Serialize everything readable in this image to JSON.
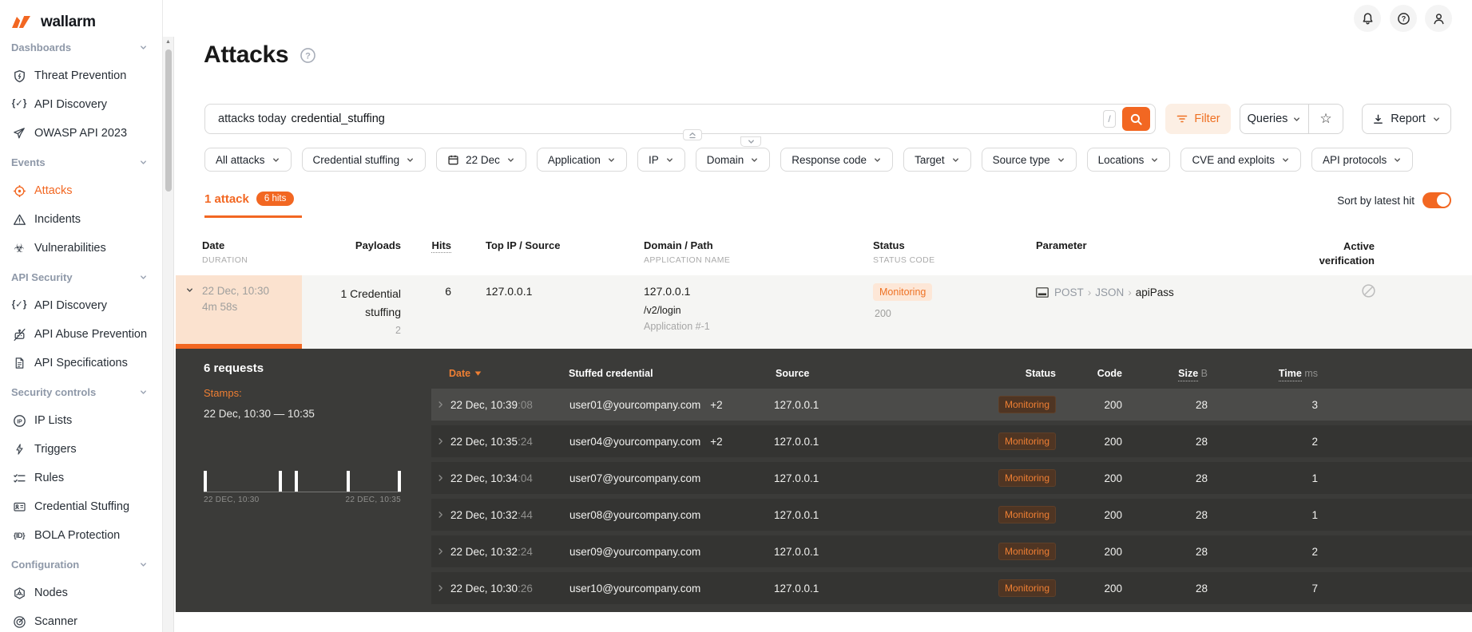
{
  "colors": {
    "accent": "#f26722",
    "panel_bg": "#3b3b39",
    "peach": "#fbe2cf"
  },
  "brand": {
    "logo_text": "wallarm"
  },
  "topbar": {
    "icon_names": [
      "notifications-bell",
      "help-circle",
      "user-account"
    ]
  },
  "sidebar": {
    "items": [
      {
        "type": "header",
        "label": "Dashboards"
      },
      {
        "type": "item",
        "label": "Threat Prevention",
        "icon": "shield-bolt"
      },
      {
        "type": "item",
        "label": "API Discovery",
        "icon": "braces-check"
      },
      {
        "type": "item",
        "label": "OWASP API 2023",
        "icon": "paper-plane"
      },
      {
        "type": "header",
        "label": "Events"
      },
      {
        "type": "item",
        "label": "Attacks",
        "icon": "target",
        "active": true
      },
      {
        "type": "item",
        "label": "Incidents",
        "icon": "warning-triangle"
      },
      {
        "type": "item",
        "label": "Vulnerabilities",
        "icon": "biohazard"
      },
      {
        "type": "header",
        "label": "API Security"
      },
      {
        "type": "item",
        "label": "API Discovery",
        "icon": "braces-check"
      },
      {
        "type": "item",
        "label": "API Abuse Prevention",
        "icon": "bot-crossed"
      },
      {
        "type": "item",
        "label": "API Specifications",
        "icon": "doc-lines"
      },
      {
        "type": "header",
        "label": "Security controls"
      },
      {
        "type": "item",
        "label": "IP Lists",
        "icon": "ip-circle"
      },
      {
        "type": "item",
        "label": "Triggers",
        "icon": "bolt"
      },
      {
        "type": "item",
        "label": "Rules",
        "icon": "checklist"
      },
      {
        "type": "item",
        "label": "Credential Stuffing",
        "icon": "id-card"
      },
      {
        "type": "item",
        "label": "BOLA Protection",
        "icon": "id-braces"
      },
      {
        "type": "header",
        "label": "Configuration"
      },
      {
        "type": "item",
        "label": "Nodes",
        "icon": "nodes"
      },
      {
        "type": "item",
        "label": "Scanner",
        "icon": "radar"
      }
    ]
  },
  "page": {
    "title": "Attacks"
  },
  "search": {
    "value_prefix": "attacks today",
    "value_token": "credential_stuffing",
    "shortcut": "/"
  },
  "actions": {
    "filter": "Filter",
    "queries": "Queries",
    "report": "Report"
  },
  "filters": {
    "chips": [
      {
        "label": "All attacks"
      },
      {
        "label": "Credential stuffing"
      },
      {
        "label": "22 Dec",
        "icon": "calendar"
      },
      {
        "label": "Application"
      },
      {
        "label": "IP"
      },
      {
        "label": "Domain"
      },
      {
        "label": "Response code"
      },
      {
        "label": "Target"
      },
      {
        "label": "Source type"
      },
      {
        "label": "Locations"
      },
      {
        "label": "CVE and exploits"
      },
      {
        "label": "API protocols"
      }
    ]
  },
  "summary": {
    "attacks_tab": "1 attack",
    "hits_badge": "6 hits",
    "sort_label": "Sort by latest hit"
  },
  "table": {
    "columns": [
      {
        "main": "Date",
        "sub": "DURATION"
      },
      {
        "main": "Payloads"
      },
      {
        "main": "Hits"
      },
      {
        "main": "Top IP / Source"
      },
      {
        "main": "Domain / Path",
        "sub": "APPLICATION NAME"
      },
      {
        "main": "Status",
        "sub": "STATUS CODE"
      },
      {
        "main": "Parameter"
      },
      {
        "main": "Active verification"
      }
    ],
    "row": {
      "date": "22 Dec, 10:30",
      "duration": "4m 58s",
      "payload": "1 Credential stuffing",
      "payload_count": "2",
      "hits": "6",
      "top_ip": "127.0.0.1",
      "domain": "127.0.0.1",
      "path": "/v2/login",
      "app_name": "Application #-1",
      "status": "Monitoring",
      "status_code": "200",
      "param_method": "POST",
      "param_format": "JSON",
      "param_name": "apiPass"
    }
  },
  "panel": {
    "requests_title": "6 requests",
    "stamps_label": "Stamps:",
    "range": "22 Dec, 10:30 — 10:35",
    "histogram": {
      "type": "event-ticks",
      "positions_fraction": [
        0,
        0.387,
        0.469,
        0.737,
        1.0
      ],
      "start_label": "22 DEC, 10:30",
      "end_label": "22 DEC, 10:35"
    },
    "table_headers": {
      "date": "Date",
      "credential": "Stuffed credential",
      "source": "Source",
      "status": "Status",
      "code": "Code",
      "size": "Size",
      "size_unit": "B",
      "time": "Time",
      "time_unit": "ms"
    },
    "rows": [
      {
        "date": "22 Dec, 10:39",
        "seconds": ":08",
        "credential": "user01@yourcompany.com",
        "extra": "+2",
        "source": "127.0.0.1",
        "status": "Monitoring",
        "code": "200",
        "size": "28",
        "time": "3",
        "highlighted": true
      },
      {
        "date": "22 Dec, 10:35",
        "seconds": ":24",
        "credential": "user04@yourcompany.com",
        "extra": "+2",
        "source": "127.0.0.1",
        "status": "Monitoring",
        "code": "200",
        "size": "28",
        "time": "2"
      },
      {
        "date": "22 Dec, 10:34",
        "seconds": ":04",
        "credential": "user07@yourcompany.com",
        "extra": "",
        "source": "127.0.0.1",
        "status": "Monitoring",
        "code": "200",
        "size": "28",
        "time": "1"
      },
      {
        "date": "22 Dec, 10:32",
        "seconds": ":44",
        "credential": "user08@yourcompany.com",
        "extra": "",
        "source": "127.0.0.1",
        "status": "Monitoring",
        "code": "200",
        "size": "28",
        "time": "1"
      },
      {
        "date": "22 Dec, 10:32",
        "seconds": ":24",
        "credential": "user09@yourcompany.com",
        "extra": "",
        "source": "127.0.0.1",
        "status": "Monitoring",
        "code": "200",
        "size": "28",
        "time": "2"
      },
      {
        "date": "22 Dec, 10:30",
        "seconds": ":26",
        "credential": "user10@yourcompany.com",
        "extra": "",
        "source": "127.0.0.1",
        "status": "Monitoring",
        "code": "200",
        "size": "28",
        "time": "7"
      }
    ]
  }
}
